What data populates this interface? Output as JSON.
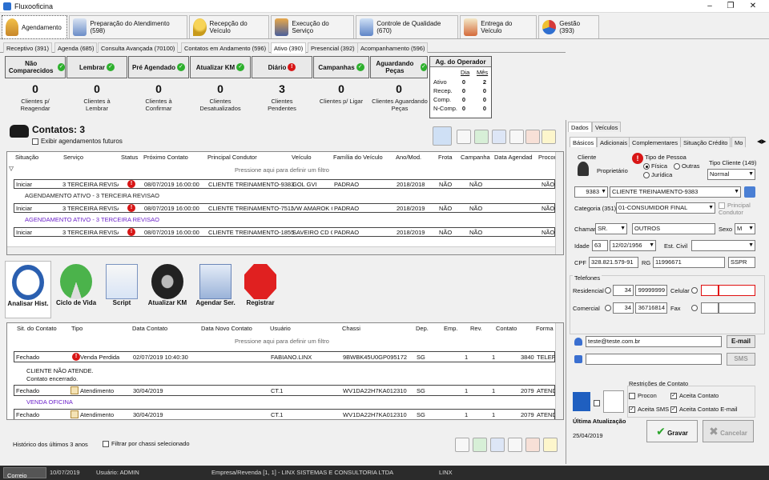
{
  "window": {
    "title": "Fluxooficina"
  },
  "main_tabs": [
    {
      "label": "Agendamento"
    },
    {
      "label": "Preparação do Atendimento (598)"
    },
    {
      "label": "Recepção do Veículo"
    },
    {
      "label": "Execução do Serviço"
    },
    {
      "label": "Controle de Qualidade (670)"
    },
    {
      "label": "Entrega do Veículo"
    },
    {
      "label": "Gestão (393)"
    }
  ],
  "sub_tabs": [
    {
      "label": "Receptivo (391)"
    },
    {
      "label": "Agenda (685)"
    },
    {
      "label": "Consulta Avançada (70100)"
    },
    {
      "label": "Contatos em Andamento (596)"
    },
    {
      "label": "Ativo (390)"
    },
    {
      "label": "Presencial (392)"
    },
    {
      "label": "Acompanhamento (596)"
    }
  ],
  "summary": [
    {
      "header": "Não Comparecidos",
      "count": "0",
      "label": "Clientes p/ Reagendar"
    },
    {
      "header": "Lembrar",
      "count": "0",
      "label": "Clientes à Lembrar"
    },
    {
      "header": "Pré Agendado",
      "count": "0",
      "label": "Clientes à Confirmar"
    },
    {
      "header": "Atualizar KM",
      "count": "0",
      "label": "Clientes Desatualizados"
    },
    {
      "header": "Diário",
      "count": "3",
      "label": "Clientes Pendentes"
    },
    {
      "header": "Campanhas",
      "count": "0",
      "label": "Clientes p/ Ligar"
    },
    {
      "header": "Aguardando Peças",
      "count": "0",
      "label": "Clientes Aguardando Peças"
    }
  ],
  "ag_operador": {
    "title": "Ag. do Operador",
    "col_dia": "Dia",
    "col_mes": "Mês",
    "rows": [
      {
        "label": "Ativo",
        "dia": "0",
        "mes": "2"
      },
      {
        "label": "Recep.",
        "dia": "0",
        "mes": "0"
      },
      {
        "label": "Comp.",
        "dia": "0",
        "mes": "0"
      },
      {
        "label": "N-Comp.",
        "dia": "0",
        "mes": "0"
      }
    ]
  },
  "contatos": {
    "title": "Contatos: 3",
    "checkbox_label": "Exibir agendamentos futuros",
    "filter_hint": "Pressione aqui para definir um filtro",
    "columns": [
      "Situação",
      "Serviço",
      "Status",
      "Próximo Contato",
      "Principal Condutor",
      "Veículo",
      "Família do Veículo",
      "Ano/Mod.",
      "Frota",
      "Campanha",
      "Data Agendad",
      "Procon"
    ],
    "rows": [
      {
        "situacao": "Iniciar",
        "servico": "3 TERCEIRA REVISA",
        "proximo": "08/07/2019 16:00:00",
        "condutor": "CLIENTE TREINAMENTO-9383",
        "veiculo": "GOL GVI",
        "familia": "PADRAO",
        "ano": "2018/2018",
        "frota": "NÃO",
        "campanha": "NÃO",
        "procon": "NÃO",
        "note": "AGENDAMENTO ATIVO - 3 TERCEIRA REVISAO"
      },
      {
        "situacao": "Iniciar",
        "servico": "3 TERCEIRA REVISA",
        "proximo": "08/07/2019 16:00:00",
        "condutor": "CLIENTE TREINAMENTO-7511",
        "veiculo": "VW AMAROK C",
        "familia": "PADRAO",
        "ano": "2018/2019",
        "frota": "NÃO",
        "campanha": "NÃO",
        "procon": "NÃO",
        "note": "AGENDAMENTO ATIVO - 3 TERCEIRA REVISAO"
      },
      {
        "situacao": "Iniciar",
        "servico": "3 TERCEIRA REVISA",
        "proximo": "08/07/2019 16:00:00",
        "condutor": "CLIENTE TREINAMENTO-1855",
        "veiculo": "SAVEIRO CD C",
        "familia": "PADRAO",
        "ano": "2018/2019",
        "frota": "NÃO",
        "campanha": "NÃO",
        "procon": "NÃO",
        "note": ""
      }
    ]
  },
  "actions": [
    {
      "label": "Analisar Hist."
    },
    {
      "label": "Ciclo de Vida"
    },
    {
      "label": "Script"
    },
    {
      "label": "Atualizar KM"
    },
    {
      "label": "Agendar Ser."
    },
    {
      "label": "Registrar"
    }
  ],
  "historico": {
    "filter_hint": "Pressione aqui para definir um filtro",
    "columns": [
      "Sit. do Contato",
      "Tipo",
      "Data Contato",
      "Data Novo Contato",
      "Usuário",
      "Chassi",
      "Dep.",
      "Emp.",
      "Rev.",
      "Contato",
      "Forma"
    ],
    "rows": [
      {
        "sit": "Fechado",
        "tipo": "Venda Perdida",
        "data": "02/07/2019 10:40:30",
        "usuario": "FABIANO.LINX",
        "chassi": "9BWBK45U0GP095172",
        "dep": "SG",
        "emp": "1",
        "rev": "1",
        "contato": "3840",
        "forma": "TELEF",
        "note1": "CLIENTE NÃO ATENDE.",
        "note2": "Contato encerrado."
      },
      {
        "sit": "Fechado",
        "tipo": "Atendimento",
        "data": "30/04/2019",
        "usuario": "CT.1",
        "chassi": "WV1DA22H7KA012310",
        "dep": "SG",
        "emp": "1",
        "rev": "1",
        "contato": "2079",
        "forma": "ATEND",
        "note1": "VENDA OFICINA",
        "note2": ""
      },
      {
        "sit": "Fechado",
        "tipo": "Atendimento",
        "data": "30/04/2019",
        "usuario": "CT.1",
        "chassi": "WV1DA22H7KA012310",
        "dep": "SG",
        "emp": "1",
        "rev": "1",
        "contato": "2079",
        "forma": "ATEND",
        "note1": "",
        "note2": ""
      }
    ],
    "footer_label": "Histórico dos últimos 3 anos",
    "footer_checkbox": "Filtrar por chassi selecionado"
  },
  "right_panel": {
    "top_tabs": [
      "Dados",
      "Veículos"
    ],
    "sub_tabs": [
      "Básicos",
      "Adicionais",
      "Complementares",
      "Situação Crédito",
      "Mo"
    ],
    "cliente_label": "Cliente",
    "proprietario": "Proprietário",
    "tipo_pessoa_label": "Tipo de Pessoa",
    "tipo_fisica": "Física",
    "tipo_outras": "Outras",
    "tipo_juridica": "Jurídica",
    "tipo_cliente_label": "Tipo Cliente (149)",
    "tipo_cliente_value": "Normal",
    "cliente_code": "9383",
    "cliente_name": "CLIENTE TREINAMENTO-9383",
    "categoria_label": "Categoria (351)",
    "categoria_value": "01-CONSUMIDOR FINAL",
    "principal_condutor": "Principal Condutor",
    "chamar_label": "Chamar",
    "chamar_value": "SR.",
    "chamar_text": "OUTROS",
    "sexo_label": "Sexo",
    "sexo_value": "M",
    "idade_label": "Idade",
    "idade_value": "63",
    "nascimento": "12/02/1956",
    "estcivil_label": "Est. Civil",
    "cpf_label": "CPF",
    "cpf_value": "328.821.579-91",
    "rg_label": "RG",
    "rg_value": "11996671",
    "rg_uf": "SSPR",
    "telefones_label": "Telefones",
    "residencial_label": "Residencial",
    "res_ddd": "34",
    "res_num": "99999999",
    "celular_label": "Celular",
    "comercial_label": "Comercial",
    "com_ddd": "34",
    "com_num": "36716814",
    "fax_label": "Fax",
    "email_value": "teste@teste.com.br",
    "email_button": "E-mail",
    "sms_button": "SMS",
    "restricoes_label": "Restrições de Contato",
    "r_procon": "Procon",
    "r_aceita_contato": "Aceita Contato",
    "r_aceita_sms": "Aceita SMS",
    "r_aceita_email": "Aceita Contato E-mail",
    "ultima_label": "Última Atualização",
    "ultima_value": "25/04/2019",
    "gravar": "Gravar",
    "cancelar": "Cancelar"
  },
  "status_bar": {
    "correio": "Correio",
    "date": "10/07/2019",
    "usuario": "Usuário: ADMIN",
    "empresa": "Empresa/Revenda [1, 1] - LINX SISTEMAS E CONSULTORIA LTDA",
    "linx": "LINX"
  }
}
